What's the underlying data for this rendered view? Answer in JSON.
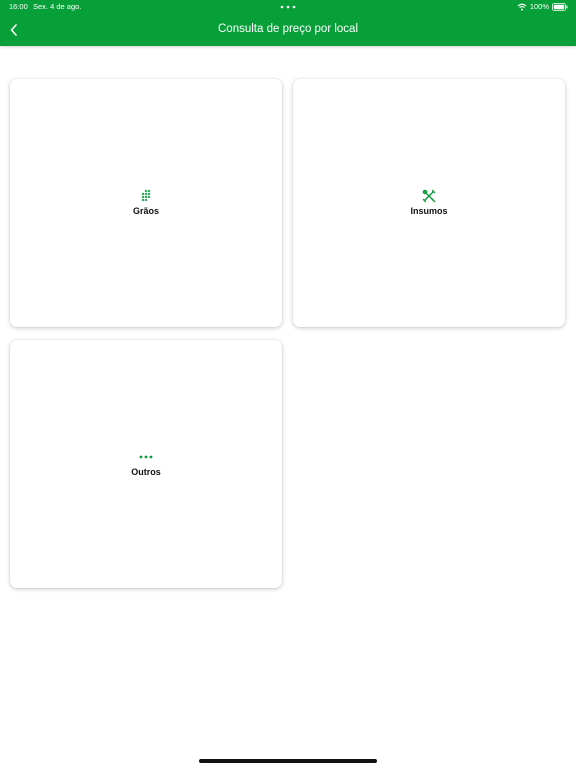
{
  "status_bar": {
    "time": "16:00",
    "date": "Sex. 4 de ago.",
    "battery": "100%"
  },
  "header": {
    "title": "Consulta de preço por local",
    "back_icon": "chevron-left-icon"
  },
  "categories": [
    {
      "label": "Grãos",
      "icon": "grains-icon"
    },
    {
      "label": "Insumos",
      "icon": "tools-icon"
    },
    {
      "label": "Outros",
      "icon": "more-dots-icon"
    }
  ],
  "colors": {
    "brand_green": "#07a038",
    "icon_green": "#0a9a3a",
    "background": "#ffffff"
  }
}
